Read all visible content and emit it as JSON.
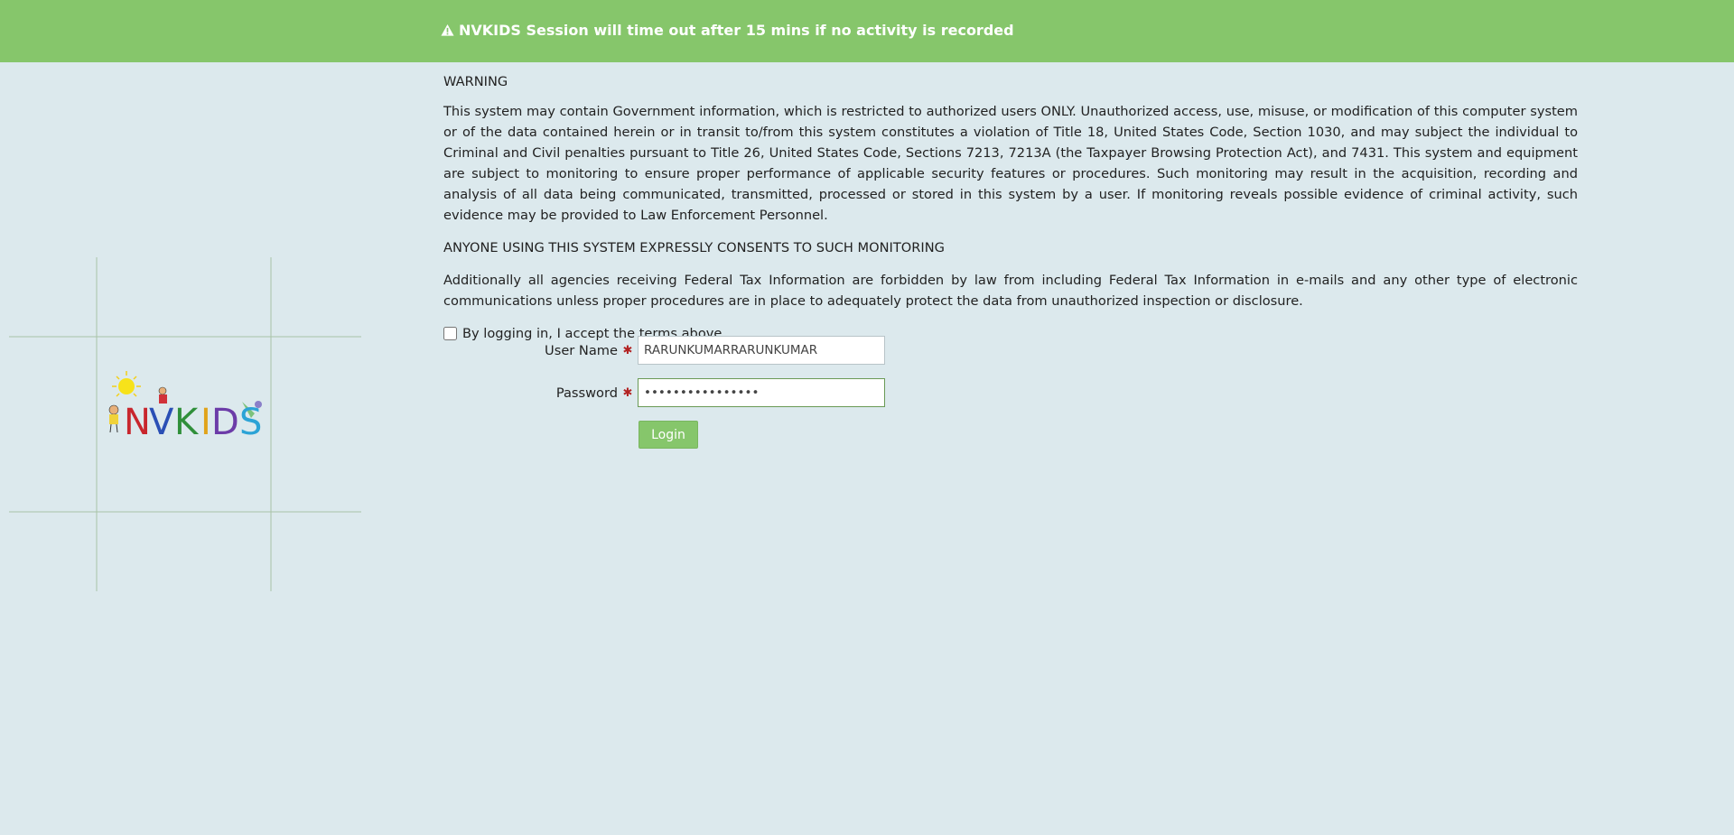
{
  "banner": {
    "icon": "warning-triangle-icon",
    "text": "NVKIDS Session will time out after 15 mins if no activity is recorded",
    "color": "#86c66b"
  },
  "logo": {
    "text": "NVKIDS"
  },
  "notice": {
    "heading": "WARNING",
    "body": "This system may contain Government information, which is restricted to authorized users ONLY. Unauthorized access, use, misuse, or modification of this computer system or of the data contained herein or in transit to/from this system constitutes a violation of Title 18, United States Code, Section 1030, and may subject the individual to Criminal and Civil penalties pursuant to Title 26, United States Code, Sections 7213, 7213A (the Taxpayer Browsing Protection Act), and 7431. This system and equipment are subject to monitoring to ensure proper performance of applicable security features or procedures. Such monitoring may result in the acquisition, recording and analysis of all data being communicated, transmitted, processed or stored in this system by a user. If monitoring reveals possible evidence of criminal activity, such evidence may be provided to Law Enforcement Personnel.",
    "consent": "ANYONE USING THIS SYSTEM EXPRESSLY CONSENTS TO SUCH MONITORING",
    "additional": "Additionally all agencies receiving Federal Tax Information are forbidden by law from including Federal Tax Information in e-mails and any other type of electronic communications unless proper procedures are in place to adequately protect the data from unauthorized inspection or disclosure."
  },
  "form": {
    "accept_label": "By logging in, I accept the terms above",
    "accept_checked": false,
    "username_label": "User Name",
    "username_value": "RARUNKUMARRARUNKUMAR",
    "password_label": "Password",
    "password_value": "••••••••••••••••",
    "required_marker": "✱",
    "login_label": "Login"
  }
}
